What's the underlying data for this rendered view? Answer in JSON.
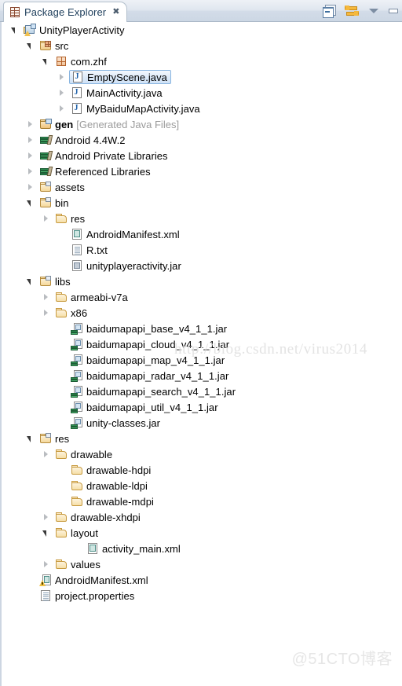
{
  "view": {
    "tab_title": "Package Explorer",
    "tab_close_glyph": "✖",
    "tab_icon": "package-explorer-icon",
    "tools": [
      {
        "name": "collapse-all-icon",
        "tooltip": "Collapse All"
      },
      {
        "name": "link-with-editor-icon",
        "tooltip": "Link with Editor"
      },
      {
        "name": "view-menu-icon",
        "tooltip": "View Menu"
      },
      {
        "name": "minimize-icon",
        "tooltip": "Minimize"
      }
    ]
  },
  "tree": {
    "rows": [
      {
        "label": "UnityPlayerActivity",
        "sub": "",
        "indent": 0,
        "twisty": "expanded",
        "icon": "ic-project",
        "icon_name": "java-project-icon",
        "selected": false,
        "bold": false
      },
      {
        "label": "src",
        "sub": "",
        "indent": 1,
        "twisty": "expanded",
        "icon": "ic-srcfolder",
        "icon_name": "source-folder-icon",
        "selected": false,
        "bold": false
      },
      {
        "label": "com.zhf",
        "sub": "",
        "indent": 2,
        "twisty": "expanded",
        "icon": "ic-package",
        "icon_name": "package-icon",
        "selected": false,
        "bold": false
      },
      {
        "label": "EmptyScene.java",
        "sub": "",
        "indent": 3,
        "twisty": "collapsed",
        "icon": "ic-java",
        "icon_name": "java-file-icon",
        "selected": true,
        "bold": false
      },
      {
        "label": "MainActivity.java",
        "sub": "",
        "indent": 3,
        "twisty": "collapsed",
        "icon": "ic-java",
        "icon_name": "java-file-icon",
        "selected": false,
        "bold": false
      },
      {
        "label": "MyBaiduMapActivity.java",
        "sub": "",
        "indent": 3,
        "twisty": "collapsed",
        "icon": "ic-java",
        "icon_name": "java-file-icon",
        "selected": false,
        "bold": false
      },
      {
        "label": "gen",
        "sub": "[Generated Java Files]",
        "indent": 1,
        "twisty": "collapsed",
        "icon": "ic-genfolder",
        "icon_name": "generated-source-folder-icon",
        "selected": false,
        "bold": true
      },
      {
        "label": "Android 4.4W.2",
        "sub": "",
        "indent": 1,
        "twisty": "collapsed",
        "icon": "ic-lib",
        "icon_name": "library-icon",
        "selected": false,
        "bold": false
      },
      {
        "label": "Android Private Libraries",
        "sub": "",
        "indent": 1,
        "twisty": "collapsed",
        "icon": "ic-lib",
        "icon_name": "library-icon",
        "selected": false,
        "bold": false
      },
      {
        "label": "Referenced Libraries",
        "sub": "",
        "indent": 1,
        "twisty": "collapsed",
        "icon": "ic-lib",
        "icon_name": "library-icon",
        "selected": false,
        "bold": false
      },
      {
        "label": "assets",
        "sub": "",
        "indent": 1,
        "twisty": "collapsed",
        "icon": "ic-folder2",
        "icon_name": "assets-folder-icon",
        "selected": false,
        "bold": false
      },
      {
        "label": "bin",
        "sub": "",
        "indent": 1,
        "twisty": "expanded",
        "icon": "ic-folder2",
        "icon_name": "bin-folder-icon",
        "selected": false,
        "bold": false
      },
      {
        "label": "res",
        "sub": "",
        "indent": 2,
        "twisty": "collapsed",
        "icon": "ic-folder",
        "icon_name": "folder-icon",
        "selected": false,
        "bold": false
      },
      {
        "label": "AndroidManifest.xml",
        "sub": "",
        "indent": 3,
        "twisty": "none",
        "icon": "ic-xml",
        "icon_name": "xml-file-icon",
        "selected": false,
        "bold": false
      },
      {
        "label": "R.txt",
        "sub": "",
        "indent": 3,
        "twisty": "none",
        "icon": "ic-text",
        "icon_name": "text-file-icon",
        "selected": false,
        "bold": false
      },
      {
        "label": "unityplayeractivity.jar",
        "sub": "",
        "indent": 3,
        "twisty": "none",
        "icon": "ic-jargrey",
        "icon_name": "jar-file-icon",
        "selected": false,
        "bold": false
      },
      {
        "label": "libs",
        "sub": "",
        "indent": 1,
        "twisty": "expanded",
        "icon": "ic-folder2",
        "icon_name": "libs-folder-icon",
        "selected": false,
        "bold": false
      },
      {
        "label": "armeabi-v7a",
        "sub": "",
        "indent": 2,
        "twisty": "collapsed",
        "icon": "ic-folder",
        "icon_name": "folder-icon",
        "selected": false,
        "bold": false
      },
      {
        "label": "x86",
        "sub": "",
        "indent": 2,
        "twisty": "collapsed",
        "icon": "ic-folder",
        "icon_name": "folder-icon",
        "selected": false,
        "bold": false
      },
      {
        "label": "baidumapapi_base_v4_1_1.jar",
        "sub": "",
        "indent": 3,
        "twisty": "none",
        "icon": "ic-jar",
        "icon_name": "jar-library-icon",
        "selected": false,
        "bold": false
      },
      {
        "label": "baidumapapi_cloud_v4_1_1.jar",
        "sub": "",
        "indent": 3,
        "twisty": "none",
        "icon": "ic-jar",
        "icon_name": "jar-library-icon",
        "selected": false,
        "bold": false
      },
      {
        "label": "baidumapapi_map_v4_1_1.jar",
        "sub": "",
        "indent": 3,
        "twisty": "none",
        "icon": "ic-jar",
        "icon_name": "jar-library-icon",
        "selected": false,
        "bold": false
      },
      {
        "label": "baidumapapi_radar_v4_1_1.jar",
        "sub": "",
        "indent": 3,
        "twisty": "none",
        "icon": "ic-jar",
        "icon_name": "jar-library-icon",
        "selected": false,
        "bold": false
      },
      {
        "label": "baidumapapi_search_v4_1_1.jar",
        "sub": "",
        "indent": 3,
        "twisty": "none",
        "icon": "ic-jar",
        "icon_name": "jar-library-icon",
        "selected": false,
        "bold": false
      },
      {
        "label": "baidumapapi_util_v4_1_1.jar",
        "sub": "",
        "indent": 3,
        "twisty": "none",
        "icon": "ic-jar",
        "icon_name": "jar-library-icon",
        "selected": false,
        "bold": false
      },
      {
        "label": "unity-classes.jar",
        "sub": "",
        "indent": 3,
        "twisty": "none",
        "icon": "ic-jar",
        "icon_name": "jar-library-icon",
        "selected": false,
        "bold": false
      },
      {
        "label": "res",
        "sub": "",
        "indent": 1,
        "twisty": "expanded",
        "icon": "ic-folder2",
        "icon_name": "res-folder-icon",
        "selected": false,
        "bold": false
      },
      {
        "label": "drawable",
        "sub": "",
        "indent": 2,
        "twisty": "collapsed",
        "icon": "ic-folder",
        "icon_name": "folder-icon",
        "selected": false,
        "bold": false
      },
      {
        "label": "drawable-hdpi",
        "sub": "",
        "indent": 3,
        "twisty": "none",
        "icon": "ic-folder",
        "icon_name": "folder-icon",
        "selected": false,
        "bold": false
      },
      {
        "label": "drawable-ldpi",
        "sub": "",
        "indent": 3,
        "twisty": "none",
        "icon": "ic-folder",
        "icon_name": "folder-icon",
        "selected": false,
        "bold": false
      },
      {
        "label": "drawable-mdpi",
        "sub": "",
        "indent": 3,
        "twisty": "none",
        "icon": "ic-folder",
        "icon_name": "folder-icon",
        "selected": false,
        "bold": false
      },
      {
        "label": "drawable-xhdpi",
        "sub": "",
        "indent": 2,
        "twisty": "collapsed",
        "icon": "ic-folder",
        "icon_name": "folder-icon",
        "selected": false,
        "bold": false
      },
      {
        "label": "layout",
        "sub": "",
        "indent": 2,
        "twisty": "expanded",
        "icon": "ic-folder",
        "icon_name": "folder-icon",
        "selected": false,
        "bold": false
      },
      {
        "label": "activity_main.xml",
        "sub": "",
        "indent": 4,
        "twisty": "none",
        "icon": "ic-xml",
        "icon_name": "xml-file-icon",
        "selected": false,
        "bold": false
      },
      {
        "label": "values",
        "sub": "",
        "indent": 2,
        "twisty": "collapsed",
        "icon": "ic-folder",
        "icon_name": "folder-icon",
        "selected": false,
        "bold": false
      },
      {
        "label": "AndroidManifest.xml",
        "sub": "",
        "indent": 1,
        "twisty": "none",
        "icon": "ic-manifest",
        "icon_name": "android-manifest-icon",
        "selected": false,
        "bold": false
      },
      {
        "label": "project.properties",
        "sub": "",
        "indent": 1,
        "twisty": "none",
        "icon": "ic-text",
        "icon_name": "properties-file-icon",
        "selected": false,
        "bold": false
      }
    ]
  },
  "watermarks": {
    "csdn": "http://blog.csdn.net/virus2014",
    "cto": "@51CTO博客"
  },
  "colors": {
    "selection_border": "#88b4e0",
    "selection_fill": "#dbe9f8",
    "tab_text": "#21415e",
    "secondary_text": "#9b9b9b",
    "panel_bg": "#ffffff",
    "titlebar_bg": "#d3dce8"
  }
}
